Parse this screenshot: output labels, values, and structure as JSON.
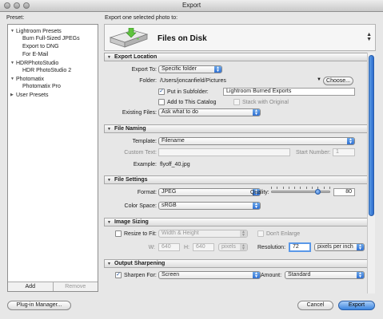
{
  "window": {
    "title": "Export"
  },
  "sidebar": {
    "label": "Preset:",
    "groups": [
      {
        "label": "Lightroom Presets",
        "items": [
          "Burn Full-Sized JPEGs",
          "Export to DNG",
          "For E-Mail"
        ]
      },
      {
        "label": "HDRPhotoStudio",
        "items": [
          "HDR PhotoStudio 2"
        ]
      },
      {
        "label": "Photomatix",
        "items": [
          "Photomatix Pro"
        ]
      },
      {
        "label": "User Presets",
        "items": []
      }
    ],
    "add_label": "Add",
    "remove_label": "Remove"
  },
  "header": {
    "subtitle": "Export one selected photo to:",
    "destination": "Files on Disk",
    "icon": "disk-download-icon"
  },
  "sections": {
    "export_location": {
      "title": "Export Location",
      "export_to_label": "Export To:",
      "export_to_value": "Specific folder",
      "folder_label": "Folder:",
      "folder_path": "/Users/joncanfield/Pictures",
      "choose_label": "Choose...",
      "subfolder_label": "Put in Subfolder:",
      "subfolder_checked": true,
      "subfolder_value": "Lightroom Burned Exports",
      "add_catalog_label": "Add to This Catalog",
      "add_catalog_checked": false,
      "stack_label": "Stack with Original",
      "existing_label": "Existing Files:",
      "existing_value": "Ask what to do"
    },
    "file_naming": {
      "title": "File Naming",
      "template_label": "Template:",
      "template_value": "Filename",
      "custom_text_label": "Custom Text:",
      "start_number_label": "Start Number:",
      "start_number_value": "1",
      "example_label": "Example:",
      "example_value": "flyoff_40.jpg"
    },
    "file_settings": {
      "title": "File Settings",
      "format_label": "Format:",
      "format_value": "JPEG",
      "quality_label": "Quality:",
      "quality_value": "80",
      "quality_level": 80,
      "color_space_label": "Color Space:",
      "color_space_value": "sRGB"
    },
    "image_sizing": {
      "title": "Image Sizing",
      "resize_label": "Resize to Fit:",
      "resize_checked": false,
      "resize_value": "Width & Height",
      "dont_enlarge_label": "Don't Enlarge",
      "w_label": "W:",
      "w_value": "640",
      "h_label": "H:",
      "h_value": "640",
      "unit_value": "pixels",
      "resolution_label": "Resolution:",
      "resolution_value": "72",
      "resolution_unit": "pixels per inch"
    },
    "output_sharpening": {
      "title": "Output Sharpening",
      "sharpen_label": "Sharpen For:",
      "sharpen_checked": true,
      "sharpen_value": "Screen",
      "amount_label": "Amount:",
      "amount_value": "Standard"
    }
  },
  "footer": {
    "plugin_label": "Plug-in Manager...",
    "cancel_label": "Cancel",
    "export_label": "Export"
  },
  "colors": {
    "accent": "#3b85df",
    "window_bg": "#e7e7e7"
  }
}
